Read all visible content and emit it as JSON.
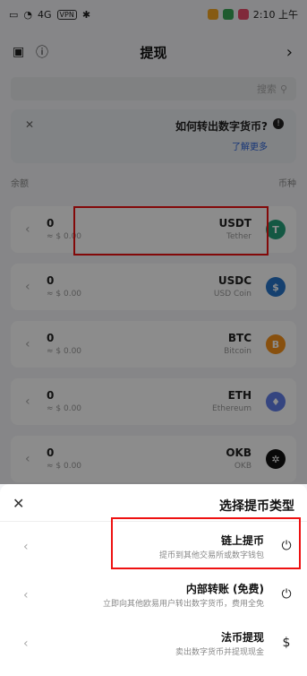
{
  "status_bar": {
    "time": "2:10 上午",
    "network": "4G",
    "vpn": "VPN"
  },
  "header": {
    "title": "提现"
  },
  "search": {
    "placeholder": "搜索"
  },
  "info": {
    "question": "如何转出数字货币?",
    "more": "了解更多"
  },
  "columns": {
    "coin": "币种",
    "balance": "余额"
  },
  "coins": [
    {
      "symbol": "USDT",
      "name": "Tether",
      "balance": "0",
      "value": "≈ $ 0.00",
      "color": "#26a17b",
      "glyph": "T"
    },
    {
      "symbol": "USDC",
      "name": "USD Coin",
      "balance": "0",
      "value": "≈ $ 0.00",
      "color": "#2775ca",
      "glyph": "$"
    },
    {
      "symbol": "BTC",
      "name": "Bitcoin",
      "balance": "0",
      "value": "≈ $ 0.00",
      "color": "#f7931a",
      "glyph": "B"
    },
    {
      "symbol": "ETH",
      "name": "Ethereum",
      "balance": "0",
      "value": "≈ $ 0.00",
      "color": "#627eea",
      "glyph": "♦"
    },
    {
      "symbol": "OKB",
      "name": "OKB",
      "balance": "0",
      "value": "≈ $ 0.00",
      "color": "#111111",
      "glyph": "✲"
    }
  ],
  "sheet": {
    "title": "选择提币类型",
    "options": [
      {
        "title": "链上提币",
        "desc": "提币到其他交易所或数字钱包"
      },
      {
        "title": "内部转账 (免费)",
        "desc": "立即向其他欧易用户转出数字货币，费用全免"
      },
      {
        "title": "法币提现",
        "desc": "卖出数字货币并提现现金"
      }
    ]
  },
  "colors": {
    "highlight": "#e11111",
    "link": "#2b63d9"
  }
}
